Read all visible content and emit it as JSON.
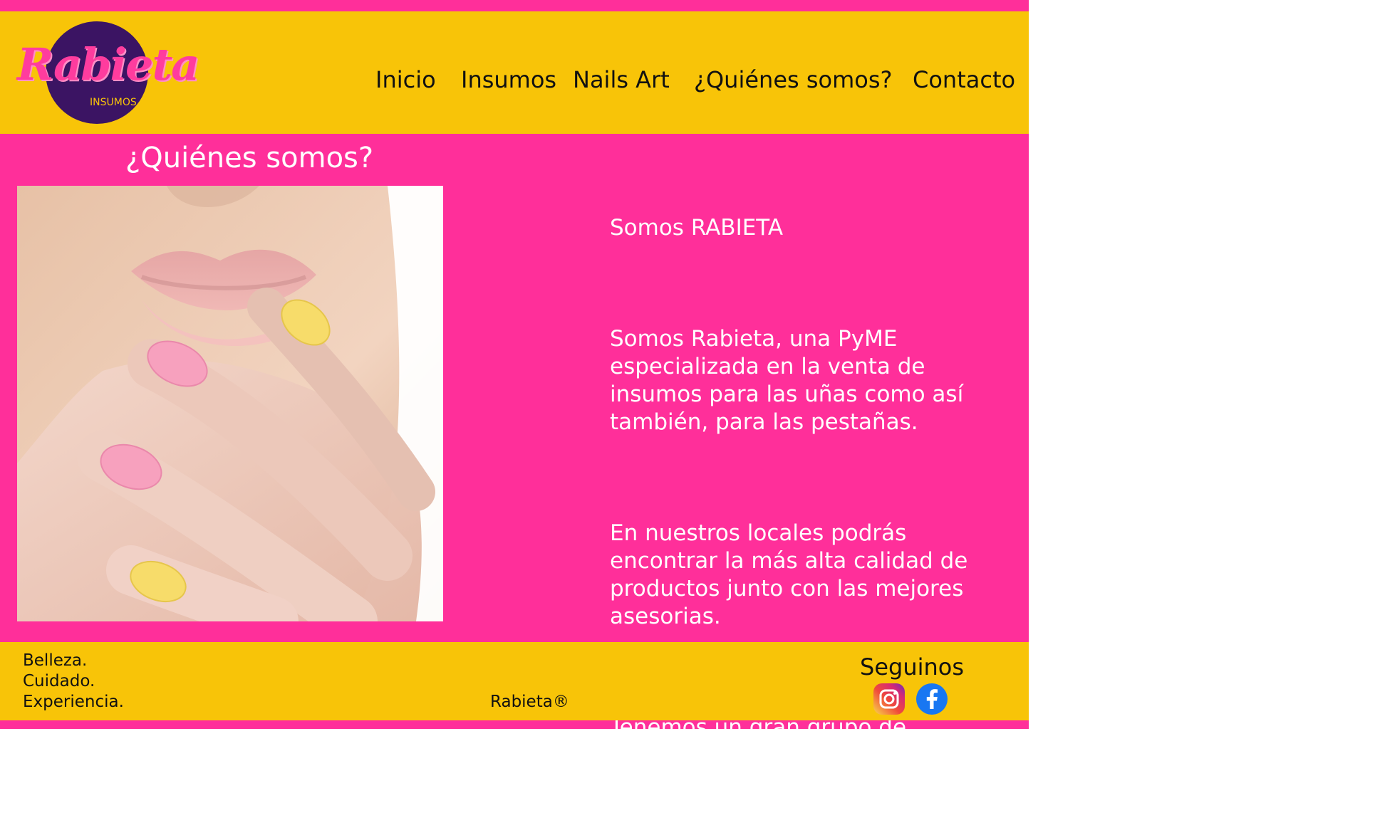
{
  "header": {
    "logo": {
      "wordmark": "Rabieta",
      "subtitle": "INSUMOS"
    },
    "nav": [
      {
        "label": "Inicio"
      },
      {
        "label": "Insumos"
      },
      {
        "label": "Nails Art"
      },
      {
        "label": "¿Quiénes somos?"
      },
      {
        "label": "Contacto"
      }
    ]
  },
  "main": {
    "title": "¿Quiénes somos?",
    "about": {
      "heading": "Somos RABIETA",
      "paragraphs": [
        "Somos Rabieta, una PyME especializada en la venta de insumos para las uñas como así también, para las pestañas.",
        "En nuestros locales podrás encontrar la más alta calidad de productos junto con las mejores asesorias.",
        "Tenemos un gran grupo de expertos preparados para asesorarte en lo que necesites."
      ]
    }
  },
  "footer": {
    "tagline": [
      "Belleza.",
      "Cuidado.",
      "Experiencia."
    ],
    "brand": "Rabieta®",
    "follow_label": "Seguinos",
    "social": [
      {
        "icon": "instagram-icon"
      },
      {
        "icon": "facebook-icon"
      }
    ]
  },
  "colors": {
    "pink": "#ff2f9a",
    "yellow": "#f8c408",
    "logo_purple": "#3b1463",
    "text_dark": "#111111",
    "text_light": "#ffffff"
  }
}
